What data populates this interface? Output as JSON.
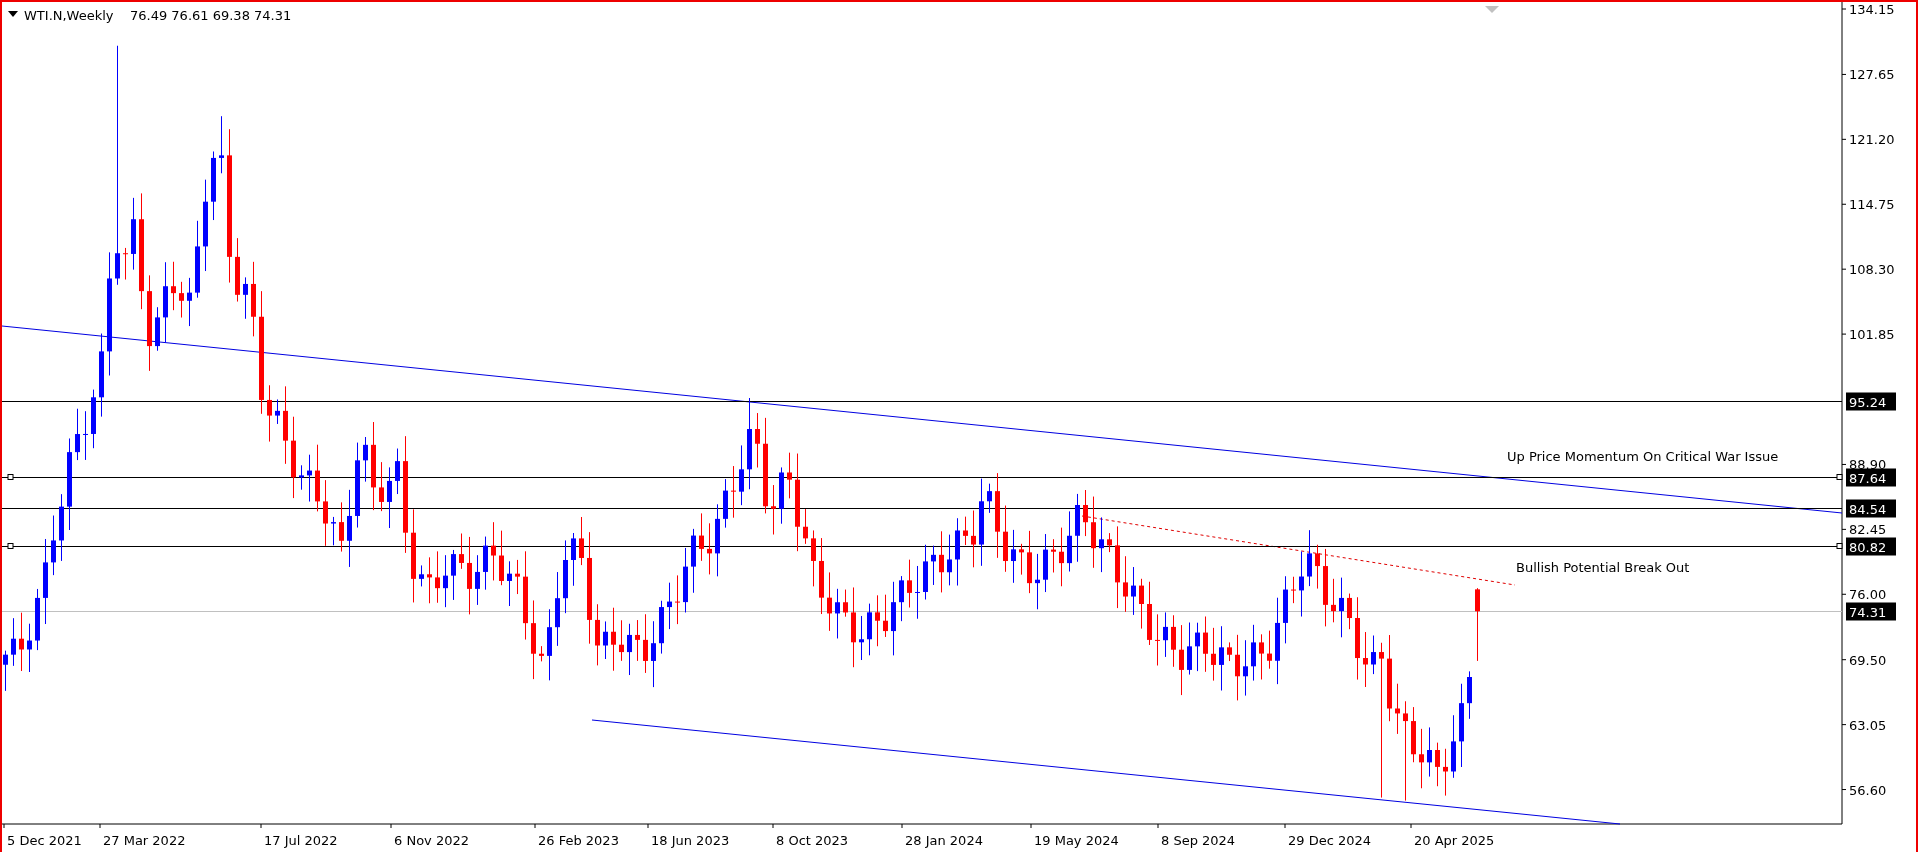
{
  "header": {
    "symbol": "WTI.N,Weekly",
    "ohlc": "76.49 76.61 69.38 74.31"
  },
  "price_axis": {
    "labels": [
      "134.15",
      "127.65",
      "121.20",
      "114.75",
      "108.30",
      "101.85",
      "88.90",
      "82.45",
      "76.00",
      "69.50",
      "63.05",
      "56.60"
    ]
  },
  "price_levels": [
    {
      "label": "95.24",
      "kind": "line",
      "handles": false
    },
    {
      "label": "87.64",
      "kind": "line",
      "handles": true
    },
    {
      "label": "84.54",
      "kind": "line",
      "handles": false
    },
    {
      "label": "80.82",
      "kind": "line",
      "handles": true
    },
    {
      "label": "74.31",
      "kind": "current",
      "handles": false
    }
  ],
  "date_axis": {
    "labels": [
      "5 Dec 2021",
      "27 Mar 2022",
      "17 Jul 2022",
      "6 Nov 2022",
      "26 Feb 2023",
      "18 Jun 2023",
      "8 Oct 2023",
      "28 Jan 2024",
      "19 May 2024",
      "8 Sep 2024",
      "29 Dec 2024",
      "20 Apr 2025"
    ]
  },
  "annotations": [
    {
      "text": "Up Price Momentum On Critical War Issue"
    },
    {
      "text": "Bullish Potential Break Out"
    }
  ]
}
